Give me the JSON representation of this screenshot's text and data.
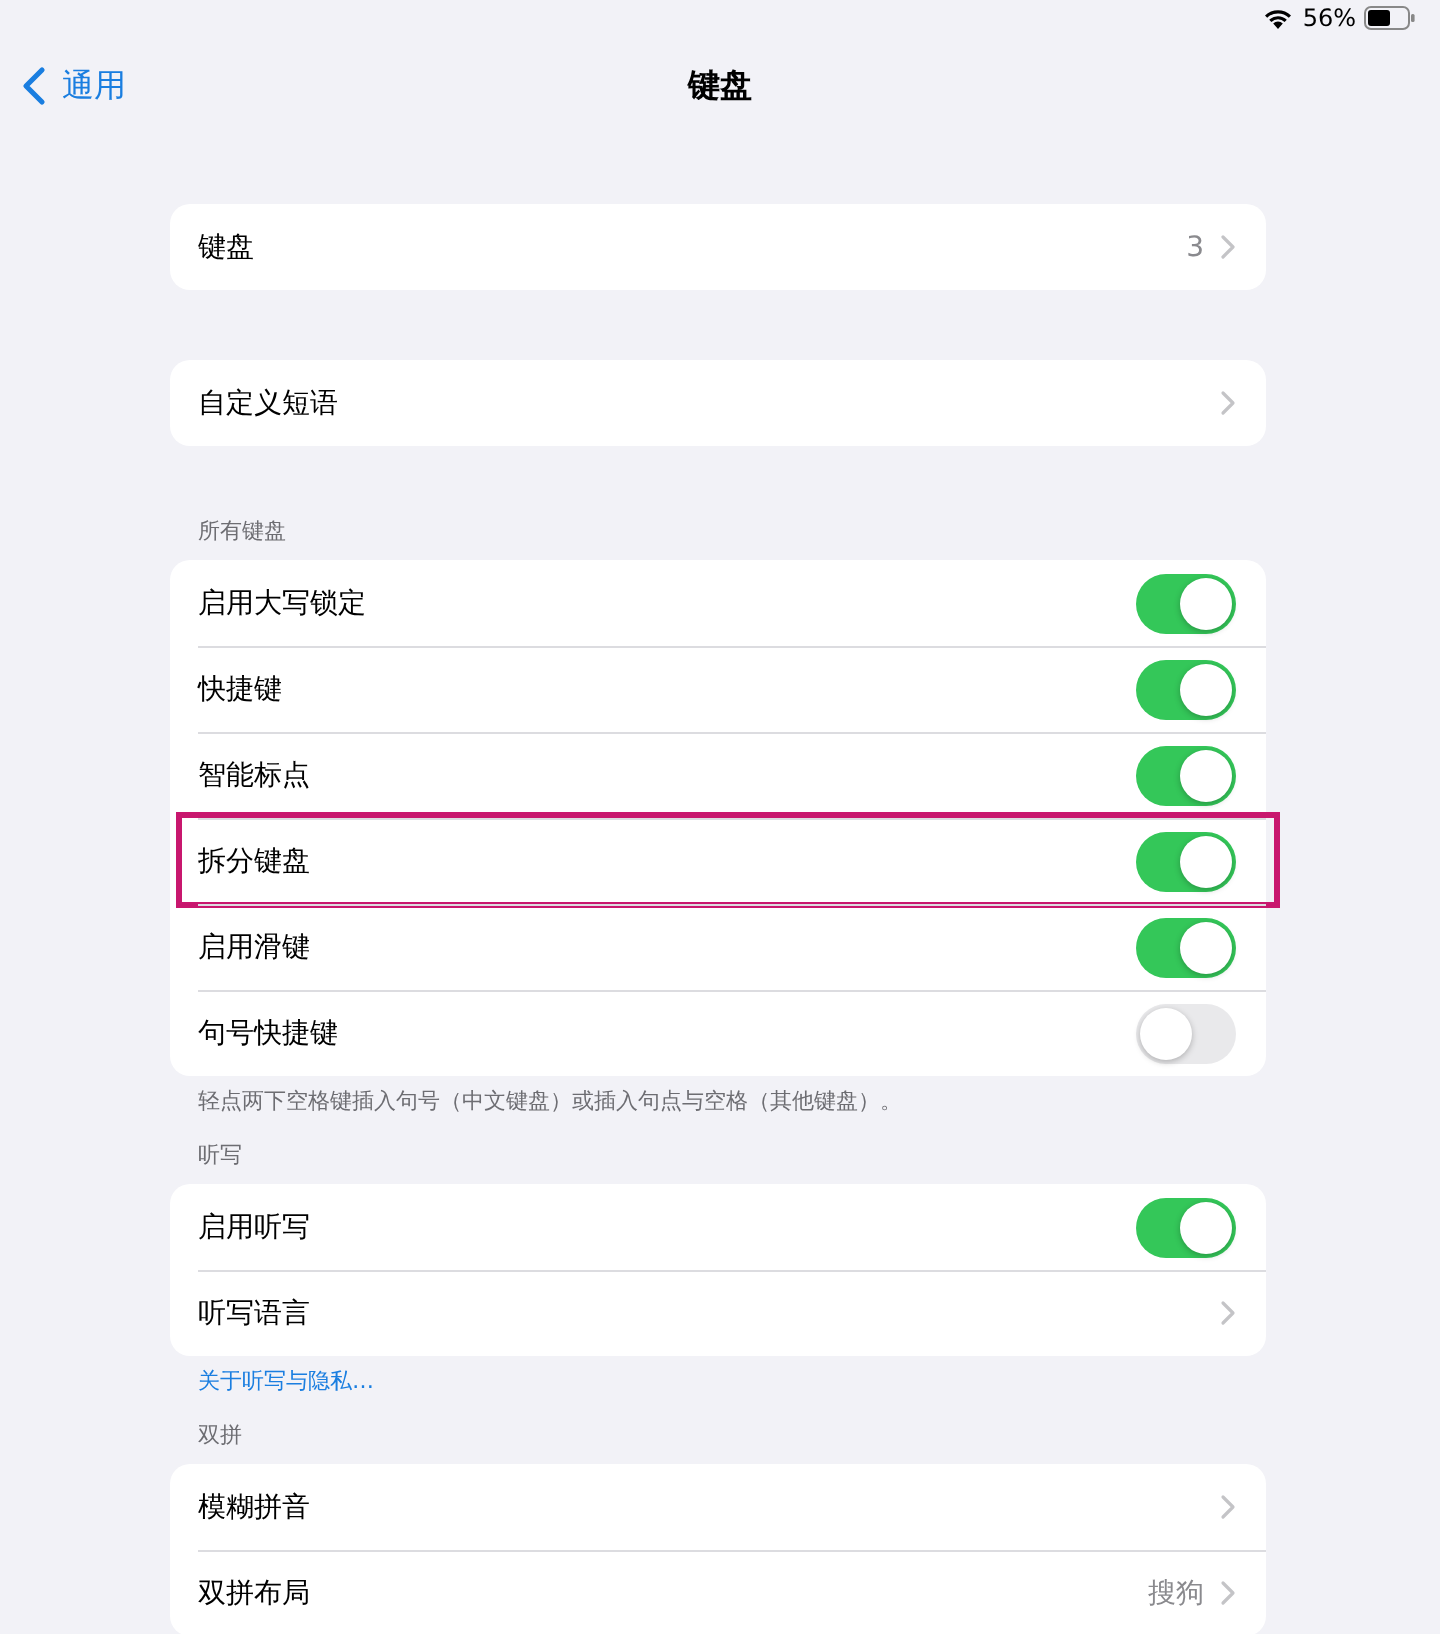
{
  "status_bar": {
    "battery_text": "56%"
  },
  "nav": {
    "back": "通用",
    "title": "键盘"
  },
  "sections": [
    {
      "rows": [
        {
          "kind": "value",
          "label": "键盘",
          "value": "3",
          "highlighted": false
        }
      ]
    },
    {
      "rows": [
        {
          "kind": "link",
          "label": "自定义短语",
          "highlighted": false
        }
      ]
    },
    {
      "header": "所有键盘",
      "rows": [
        {
          "kind": "toggle",
          "label": "启用大写锁定",
          "on": true,
          "highlighted": false
        },
        {
          "kind": "toggle",
          "label": "快捷键",
          "on": true,
          "highlighted": false
        },
        {
          "kind": "toggle",
          "label": "智能标点",
          "on": true,
          "highlighted": false
        },
        {
          "kind": "toggle",
          "label": "拆分键盘",
          "on": true,
          "highlighted": true
        },
        {
          "kind": "toggle",
          "label": "启用滑键",
          "on": true,
          "highlighted": false
        },
        {
          "kind": "toggle",
          "label": "句号快捷键",
          "on": false,
          "highlighted": false
        }
      ],
      "footer": {
        "kind": "note",
        "text": "轻点两下空格键插入句号（中文键盘）或插入句点与空格（其他键盘）。"
      }
    },
    {
      "header": "听写",
      "rows": [
        {
          "kind": "toggle",
          "label": "启用听写",
          "on": true,
          "highlighted": false
        },
        {
          "kind": "link",
          "label": "听写语言",
          "highlighted": false
        }
      ],
      "footer": {
        "kind": "link",
        "text": "关于听写与隐私…"
      }
    },
    {
      "header": "双拼",
      "rows": [
        {
          "kind": "link",
          "label": "模糊拼音",
          "highlighted": false
        },
        {
          "kind": "value",
          "label": "双拼布局",
          "value": "搜狗",
          "highlighted": false
        }
      ]
    }
  ]
}
